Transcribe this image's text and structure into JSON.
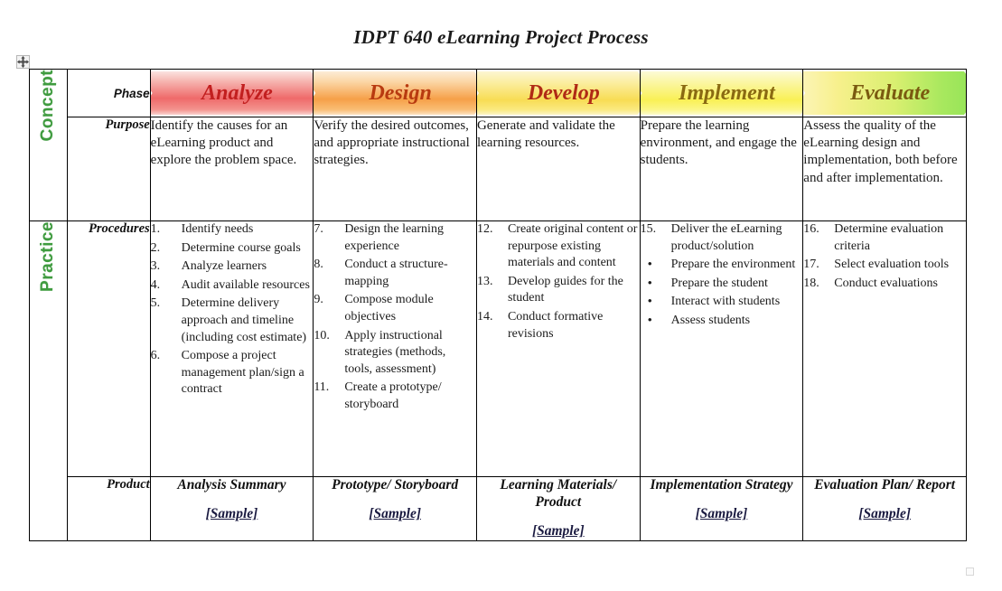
{
  "document": {
    "title": "IDPT 640 eLearning Project Process"
  },
  "handles": {
    "move_icon": "move-4way-icon",
    "resize_icon": "resize-handle-icon"
  },
  "bands": [
    {
      "label": "Concept",
      "color": "#3f9b3f"
    },
    {
      "label": "Practice",
      "color": "#3f9b3f"
    }
  ],
  "row_labels": {
    "phase": "Phase",
    "purpose": "Purpose",
    "procedures": "Procedures",
    "product": "Product"
  },
  "phases": [
    {
      "name": "Analyze",
      "accent": "#ef6a6a",
      "text_color": "#c21f1f"
    },
    {
      "name": "Design",
      "accent": "#f6a048",
      "text_color": "#b83a10"
    },
    {
      "name": "Develop",
      "accent": "#f8dc54",
      "text_color": "#b02a15"
    },
    {
      "name": "Implement",
      "accent": "#f9f055",
      "text_color": "#8a6a12"
    },
    {
      "name": "Evaluate",
      "accent": "#8fe356",
      "text_color": "#7a5a10"
    }
  ],
  "purpose": [
    "Identify the causes for an eLearning product and explore the problem space.",
    "Verify the desired outcomes, and appropriate instructional strategies.",
    "Generate and validate the learning resources.",
    "Prepare the learning environment, and engage the students.",
    "Assess the quality of the eLearning design and implementation, both before and after implementation."
  ],
  "procedures": [
    [
      {
        "marker": "1.",
        "text": "Identify needs"
      },
      {
        "marker": "2.",
        "text": "Determine course goals"
      },
      {
        "marker": "3.",
        "text": "Analyze learners"
      },
      {
        "marker": "4.",
        "text": "Audit available resources"
      },
      {
        "marker": "5.",
        "text": "Determine delivery approach and timeline (including cost estimate)"
      },
      {
        "marker": "6.",
        "text": "Compose a project management plan/sign a contract"
      }
    ],
    [
      {
        "marker": "7.",
        "text": "Design the learning experience"
      },
      {
        "marker": "8.",
        "text": "Conduct a structure-mapping"
      },
      {
        "marker": "9.",
        "text": "Compose module objectives"
      },
      {
        "marker": "10.",
        "text": "Apply instructional strategies (methods, tools, assessment)"
      },
      {
        "marker": "11.",
        "text": "Create a prototype/ storyboard"
      }
    ],
    [
      {
        "marker": "12.",
        "text": "Create original content or repurpose existing materials and content"
      },
      {
        "marker": "13.",
        "text": "Develop guides for the student"
      },
      {
        "marker": "14.",
        "text": "Conduct formative revisions"
      }
    ],
    [
      {
        "marker": "15.",
        "text": "Deliver the eLearning product/solution"
      },
      {
        "marker": "•",
        "text": "Prepare the environment",
        "bullet": true
      },
      {
        "marker": "•",
        "text": "Prepare the student",
        "bullet": true
      },
      {
        "marker": "•",
        "text": "Interact with students",
        "bullet": true
      },
      {
        "marker": "•",
        "text": "Assess students",
        "bullet": true
      }
    ],
    [
      {
        "marker": "16.",
        "text": "Determine evaluation criteria"
      },
      {
        "marker": "17.",
        "text": "Select evaluation tools"
      },
      {
        "marker": "18.",
        "text": "Conduct evaluations"
      }
    ]
  ],
  "product": [
    {
      "name": "Analysis Summary",
      "link": "[Sample]"
    },
    {
      "name": "Prototype/ Storyboard",
      "link": "[Sample]"
    },
    {
      "name": "Learning Materials/ Product",
      "link": "[Sample]"
    },
    {
      "name": "Implementation Strategy",
      "link": "[Sample]"
    },
    {
      "name": "Evaluation Plan/ Report",
      "link": "[Sample]"
    }
  ]
}
